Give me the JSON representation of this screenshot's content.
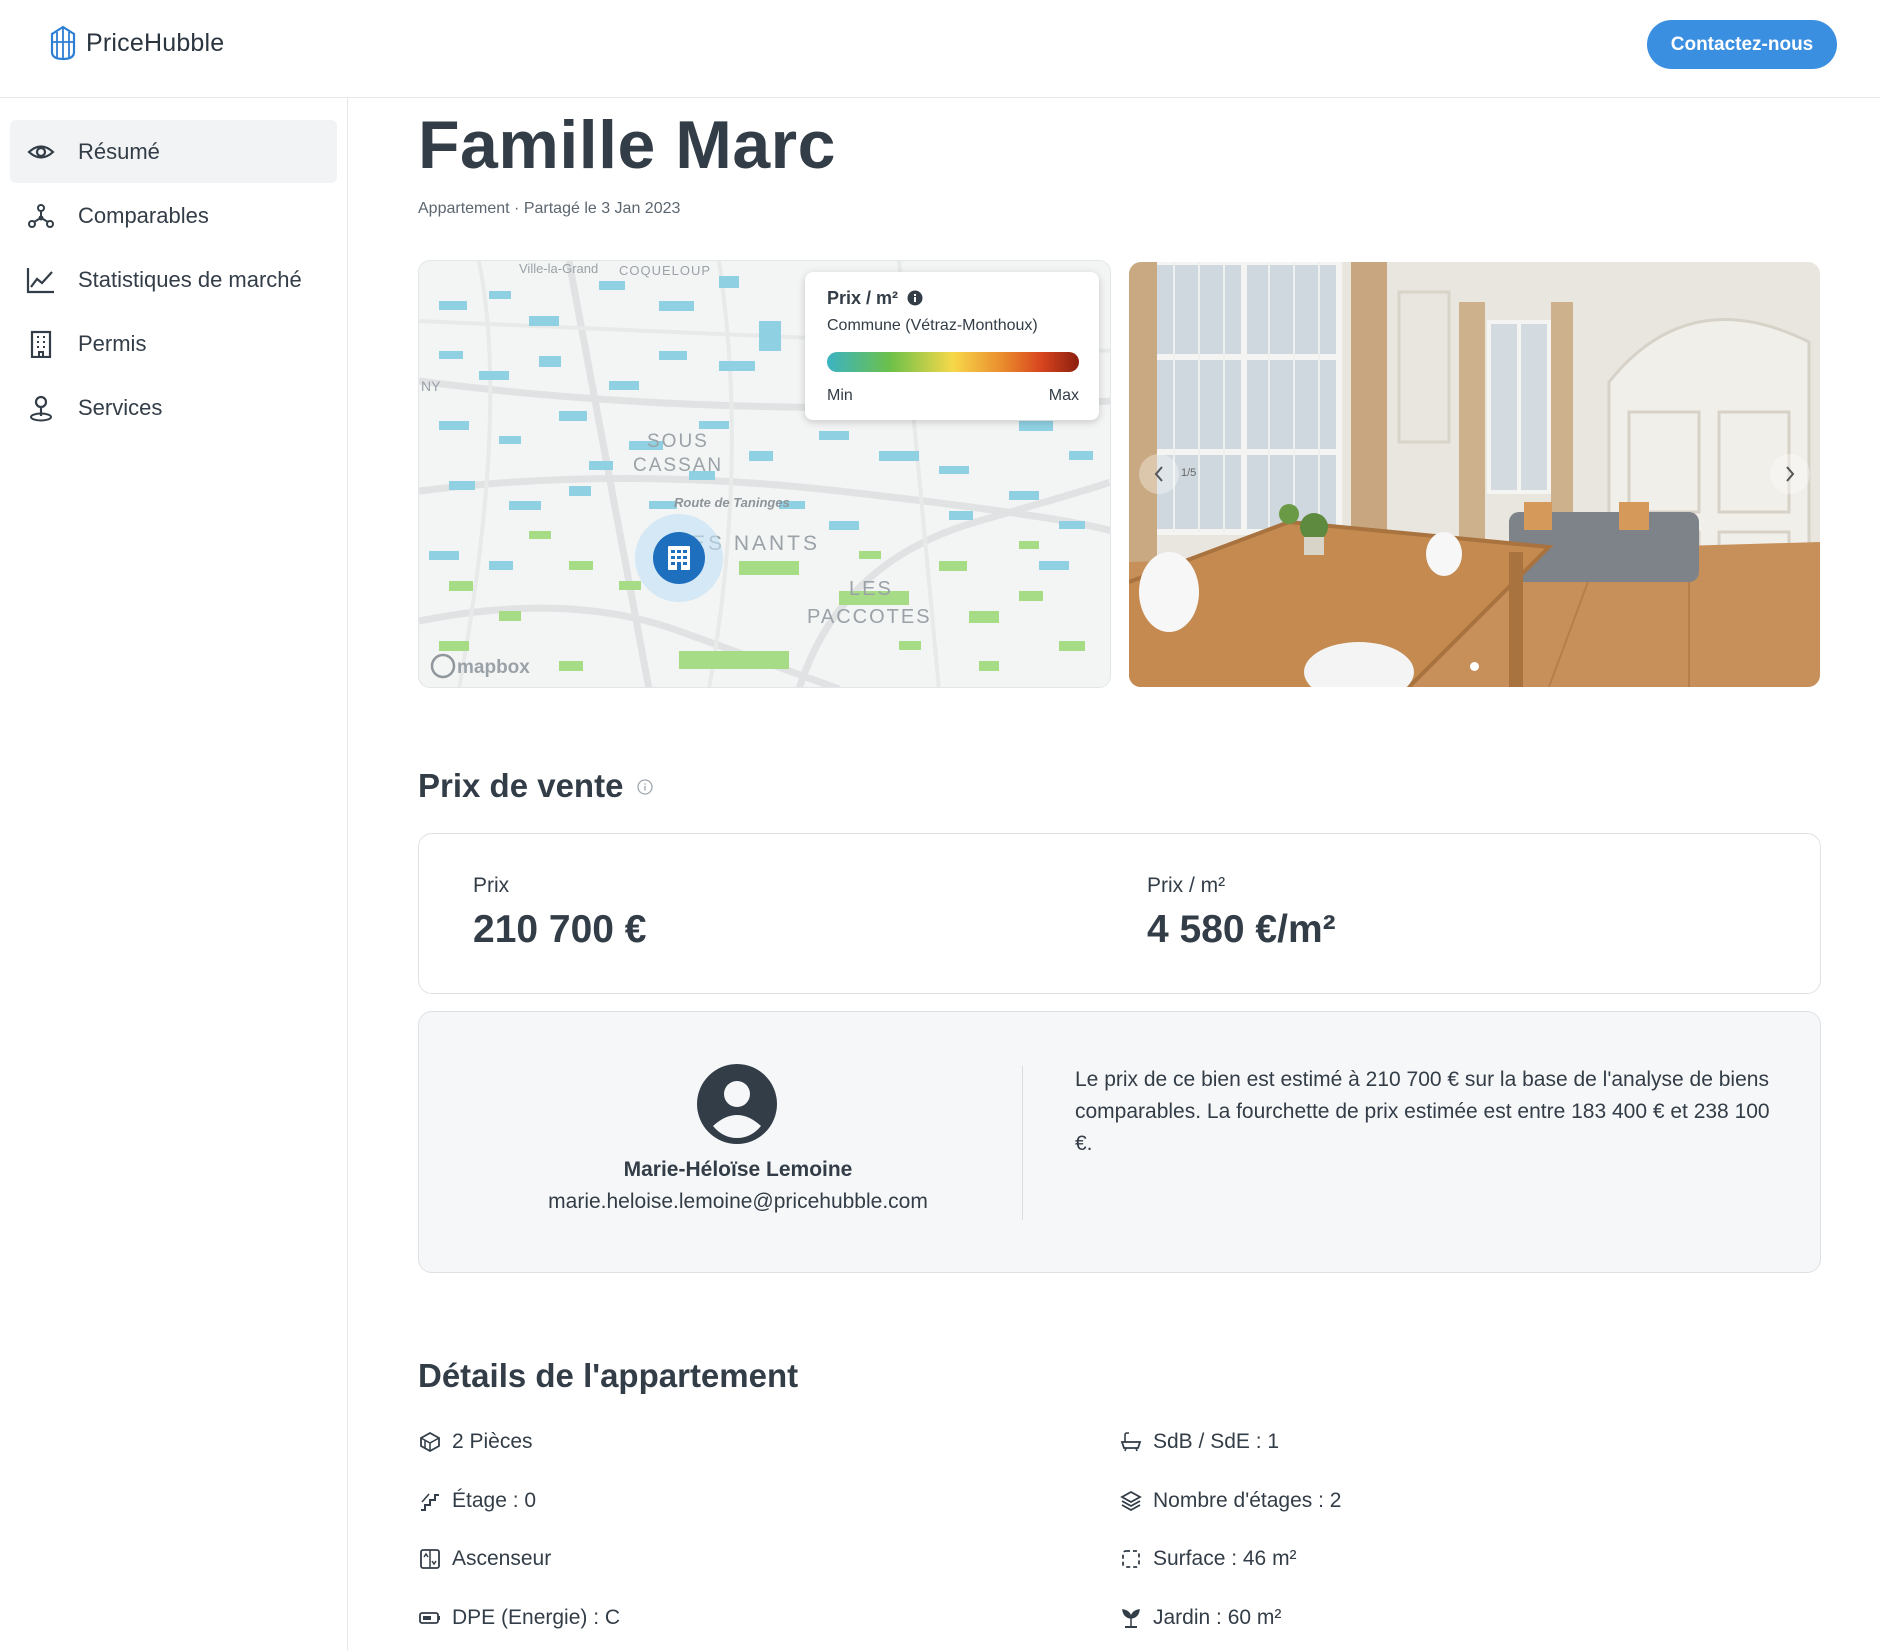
{
  "header": {
    "logo_text": "PriceHubble",
    "contact_label": "Contactez-nous"
  },
  "sidebar": {
    "items": [
      {
        "label": "Résumé",
        "icon": "eye-icon",
        "active": true
      },
      {
        "label": "Comparables",
        "icon": "network-icon",
        "active": false
      },
      {
        "label": "Statistiques de marché",
        "icon": "line-chart-icon",
        "active": false
      },
      {
        "label": "Permis",
        "icon": "building-icon",
        "active": false
      },
      {
        "label": "Services",
        "icon": "person-pin-icon",
        "active": false
      }
    ]
  },
  "page": {
    "title": "Famille Marc",
    "subtitle": "Appartement · Partagé le 3 Jan 2023"
  },
  "map": {
    "legend_title": "Prix / m²",
    "legend_sub": "Commune (Vétraz-Monthoux)",
    "legend_min": "Min",
    "legend_max": "Max",
    "labels": {
      "top_left": "Ville-la-Grand",
      "top_mid": "COQUELOUP",
      "left": "NY",
      "sous": "SOUS",
      "cassan": "CASSAN",
      "road": "Route de Taninges",
      "nants": "ES NANTS",
      "les": "LES",
      "paccotes": "PACCOTES",
      "attribution": "mapbox"
    }
  },
  "photo": {
    "slide_counter": "1/5"
  },
  "sale": {
    "section_title": "Prix de vente",
    "price_label": "Prix",
    "price_value": "210 700 €",
    "ppm_label": "Prix / m²",
    "ppm_value": "4 580 €/m²"
  },
  "agent": {
    "name": "Marie-Héloïse Lemoine",
    "email": "marie.heloise.lemoine@pricehubble.com",
    "text": "Le prix de ce bien est estimé à 210 700 € sur la base de l'analyse de biens comparables. La fourchette de prix estimée est entre 183 400 € et 238 100 €."
  },
  "details": {
    "section_title": "Détails de l'appartement",
    "left": [
      {
        "label": "2 Pièces",
        "icon": "rooms-icon"
      },
      {
        "label": "Étage : 0",
        "icon": "stairs-icon"
      },
      {
        "label": "Ascenseur",
        "icon": "elevator-icon"
      },
      {
        "label": "DPE (Energie) : C",
        "icon": "battery-icon"
      }
    ],
    "right": [
      {
        "label": "SdB / SdE : 1",
        "icon": "bathtub-icon"
      },
      {
        "label": "Nombre d'étages : 2",
        "icon": "layers-icon"
      },
      {
        "label": "Surface : 46 m²",
        "icon": "area-icon"
      },
      {
        "label": "Jardin : 60 m²",
        "icon": "plant-icon"
      }
    ]
  }
}
